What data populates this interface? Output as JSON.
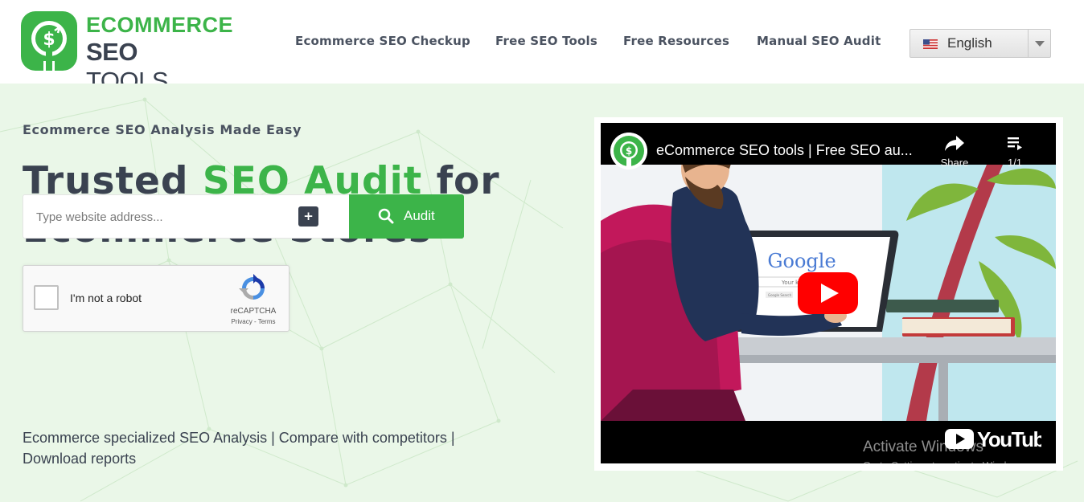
{
  "header": {
    "logo": {
      "line1": "ECOMMERCE",
      "line2_bold": "SEO",
      "line2_rest": " TOOLS"
    },
    "nav": [
      {
        "label": "Ecommerce SEO Checkup"
      },
      {
        "label": "Free SEO Tools"
      },
      {
        "label": "Free Resources"
      },
      {
        "label": "Manual SEO Audit"
      }
    ],
    "language": {
      "selected": "English",
      "flag_icon": "us-flag-icon",
      "arrow_icon": "chevron-down-icon"
    }
  },
  "hero": {
    "eyebrow": "Ecommerce SEO Analysis Made Easy",
    "headline": {
      "part1": "Trusted ",
      "highlight": "SEO Audit",
      "part2": " for",
      "line2": "Ecommerce Stores"
    },
    "search": {
      "placeholder": "Type website address...",
      "value": "",
      "plus_label": "+"
    },
    "audit_button": {
      "label": "Audit",
      "icon": "search-icon"
    },
    "recaptcha": {
      "label": "I'm not a robot",
      "brand": "reCAPTCHA",
      "privacy": "Privacy",
      "separator": " - ",
      "terms": "Terms"
    },
    "tagline": "Ecommerce specialized SEO Analysis | Compare with competitors | Download reports"
  },
  "video": {
    "title": "eCommerce SEO tools | Free SEO au...",
    "share_label": "Share",
    "playlist_label": "1/1",
    "scene_text": {
      "google": "Google",
      "your": "Your k",
      "button": "Google Search"
    },
    "platform": "YouTube"
  },
  "watermark": {
    "line1": "Activate Windows",
    "line2": "Go to Settings to activate Windows."
  },
  "colors": {
    "brand_green": "#3cb449",
    "dark_text": "#3a4250",
    "hero_bg": "#eaf7e8",
    "youtube_red": "#ff0000"
  }
}
